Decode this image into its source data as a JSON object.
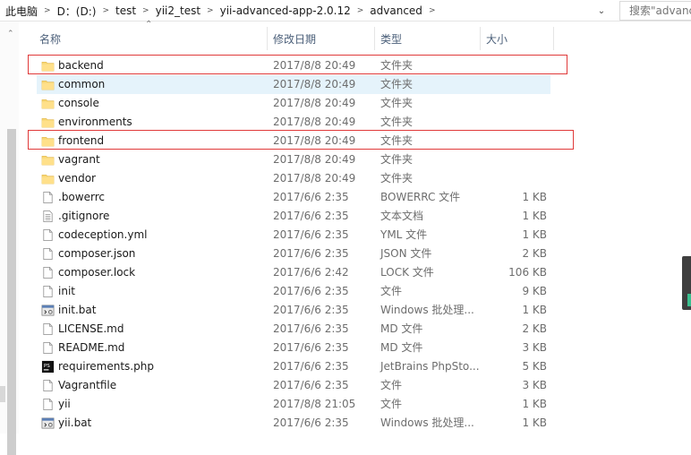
{
  "breadcrumb": [
    "此电脑",
    "D：(D:)",
    "test",
    "yii2_test",
    "yii-advanced-app-2.0.12",
    "advanced"
  ],
  "search_placeholder": "搜索\"advanced\"",
  "columns": {
    "name": "名称",
    "date": "修改日期",
    "type": "类型",
    "size": "大小"
  },
  "files": [
    {
      "name": "backend",
      "date": "2017/8/8 20:49",
      "type": "文件夹",
      "size": "",
      "icon": "folder-icon"
    },
    {
      "name": "common",
      "date": "2017/8/8 20:49",
      "type": "文件夹",
      "size": "",
      "icon": "folder-icon"
    },
    {
      "name": "console",
      "date": "2017/8/8 20:49",
      "type": "文件夹",
      "size": "",
      "icon": "folder-icon"
    },
    {
      "name": "environments",
      "date": "2017/8/8 20:49",
      "type": "文件夹",
      "size": "",
      "icon": "folder-icon"
    },
    {
      "name": "frontend",
      "date": "2017/8/8 20:49",
      "type": "文件夹",
      "size": "",
      "icon": "folder-icon"
    },
    {
      "name": "vagrant",
      "date": "2017/8/8 20:49",
      "type": "文件夹",
      "size": "",
      "icon": "folder-icon"
    },
    {
      "name": "vendor",
      "date": "2017/8/8 20:49",
      "type": "文件夹",
      "size": "",
      "icon": "folder-icon"
    },
    {
      "name": ".bowerrc",
      "date": "2017/6/6 2:35",
      "type": "BOWERRC 文件",
      "size": "1 KB",
      "icon": "file-icon"
    },
    {
      "name": ".gitignore",
      "date": "2017/6/6 2:35",
      "type": "文本文档",
      "size": "1 KB",
      "icon": "text-file-icon"
    },
    {
      "name": "codeception.yml",
      "date": "2017/6/6 2:35",
      "type": "YML 文件",
      "size": "1 KB",
      "icon": "file-icon"
    },
    {
      "name": "composer.json",
      "date": "2017/6/6 2:35",
      "type": "JSON 文件",
      "size": "2 KB",
      "icon": "file-icon"
    },
    {
      "name": "composer.lock",
      "date": "2017/6/6 2:42",
      "type": "LOCK 文件",
      "size": "106 KB",
      "icon": "file-icon"
    },
    {
      "name": "init",
      "date": "2017/6/6 2:35",
      "type": "文件",
      "size": "9 KB",
      "icon": "file-icon"
    },
    {
      "name": "init.bat",
      "date": "2017/6/6 2:35",
      "type": "Windows 批处理...",
      "size": "1 KB",
      "icon": "batch-file-icon"
    },
    {
      "name": "LICENSE.md",
      "date": "2017/6/6 2:35",
      "type": "MD 文件",
      "size": "2 KB",
      "icon": "file-icon"
    },
    {
      "name": "README.md",
      "date": "2017/6/6 2:35",
      "type": "MD 文件",
      "size": "3 KB",
      "icon": "file-icon"
    },
    {
      "name": "requirements.php",
      "date": "2017/6/6 2:35",
      "type": "JetBrains PhpSto...",
      "size": "5 KB",
      "icon": "phpstorm-file-icon"
    },
    {
      "name": "Vagrantfile",
      "date": "2017/6/6 2:35",
      "type": "文件",
      "size": "3 KB",
      "icon": "file-icon"
    },
    {
      "name": "yii",
      "date": "2017/8/8 21:05",
      "type": "文件",
      "size": "1 KB",
      "icon": "file-icon"
    },
    {
      "name": "yii.bat",
      "date": "2017/6/6 2:35",
      "type": "Windows 批处理...",
      "size": "1 KB",
      "icon": "batch-file-icon"
    }
  ],
  "selected_index": 1,
  "highlighted_indices": [
    0,
    4
  ],
  "colors": {
    "folder": "#f8d775",
    "selection": "#e5f3fb",
    "highlight_box": "#e03a3a",
    "header_text": "#4c607a"
  }
}
